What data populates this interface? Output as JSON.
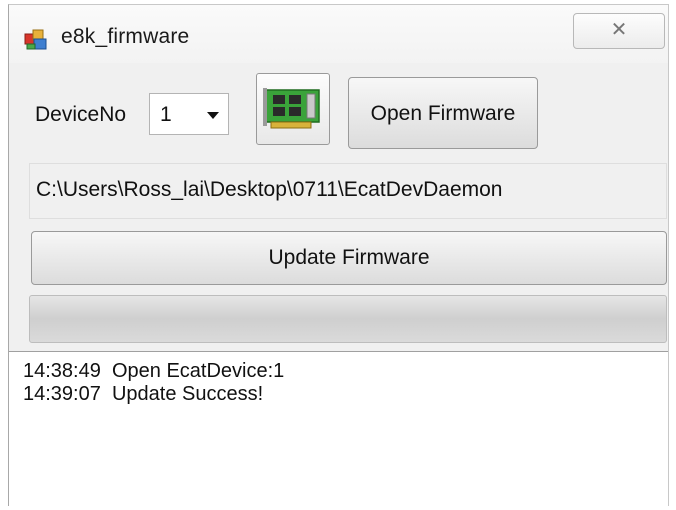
{
  "window": {
    "title": "e8k_firmware",
    "close_glyph": "✕"
  },
  "device": {
    "label": "DeviceNo",
    "selected": "1"
  },
  "buttons": {
    "card_icon": "pci-card-icon",
    "open_firmware": "Open Firmware",
    "update_firmware": "Update Firmware"
  },
  "path": {
    "value": "C:\\Users\\Ross_lai\\Desktop\\0711\\EcatDevDaemon"
  },
  "progress": {
    "fraction": 0
  },
  "log": {
    "lines": [
      {
        "time": "14:38:49",
        "message": "Open EcatDevice:1"
      },
      {
        "time": "14:39:07",
        "message": "Update Success!"
      }
    ]
  },
  "colors": {
    "window_bg": "#f0f0f0",
    "card_green": "#3aa33a"
  }
}
